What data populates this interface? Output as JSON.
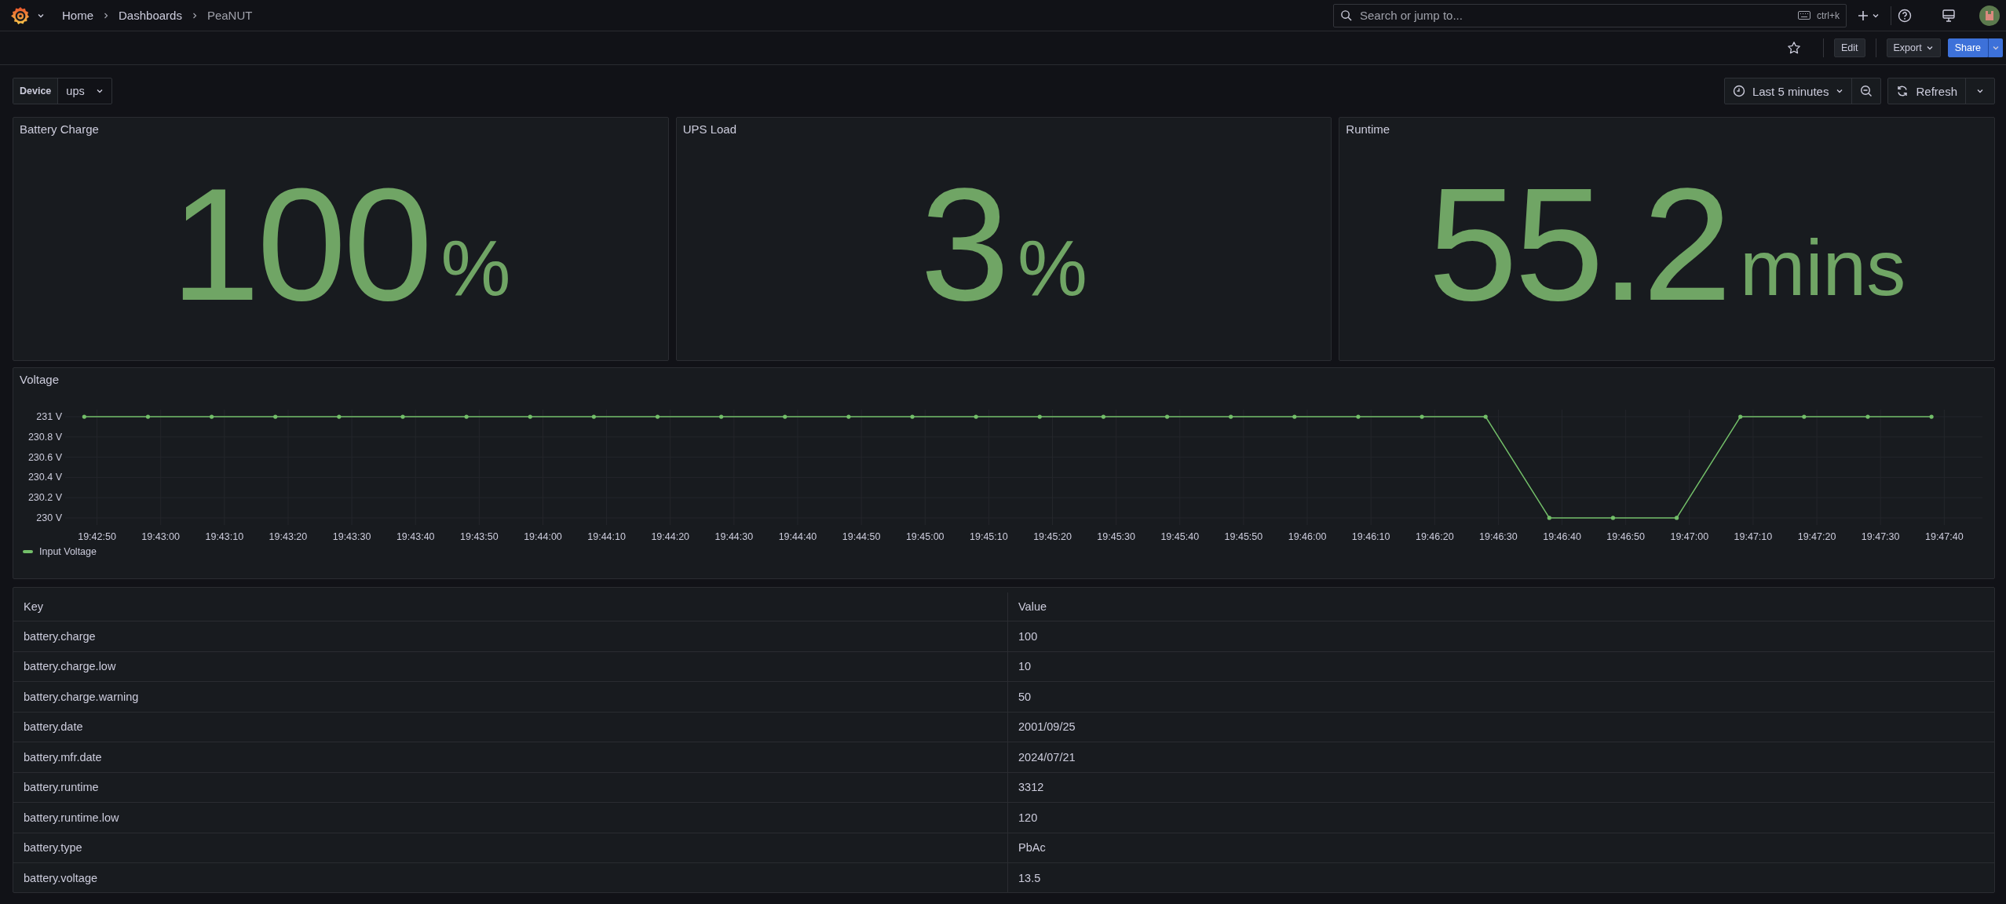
{
  "breadcrumbs": [
    "Home",
    "Dashboards",
    "PeaNUT"
  ],
  "search": {
    "placeholder": "Search or jump to...",
    "shortcut": "ctrl+k"
  },
  "toolbar": {
    "edit": "Edit",
    "export": "Export",
    "share": "Share"
  },
  "variable": {
    "label": "Device",
    "value": "ups"
  },
  "time_picker": {
    "range": "Last 5 minutes",
    "refresh": "Refresh"
  },
  "stats": [
    {
      "title": "Battery Charge",
      "value": "100",
      "unit": "%"
    },
    {
      "title": "UPS Load",
      "value": "3",
      "unit": "%"
    },
    {
      "title": "Runtime",
      "value": "55.2",
      "unit": "mins"
    }
  ],
  "voltage": {
    "title": "Voltage",
    "chart_data": {
      "type": "line",
      "categories": [
        "19:42:50",
        "19:43:00",
        "19:43:10",
        "19:43:20",
        "19:43:30",
        "19:43:40",
        "19:43:50",
        "19:44:00",
        "19:44:10",
        "19:44:20",
        "19:44:30",
        "19:44:40",
        "19:44:50",
        "19:45:00",
        "19:45:10",
        "19:45:20",
        "19:45:30",
        "19:45:40",
        "19:45:50",
        "19:46:00",
        "19:46:10",
        "19:46:20",
        "19:46:30",
        "19:46:40",
        "19:46:50",
        "19:47:00",
        "19:47:10",
        "19:47:20",
        "19:47:30",
        "19:47:40"
      ],
      "series": [
        {
          "name": "Input Voltage",
          "color": "#73bf69",
          "values": [
            231,
            231,
            231,
            231,
            231,
            231,
            231,
            231,
            231,
            231,
            231,
            231,
            231,
            231,
            231,
            231,
            231,
            231,
            231,
            231,
            231,
            231,
            231,
            230,
            230,
            230,
            231,
            231,
            231,
            231
          ]
        }
      ],
      "grid": true,
      "ylim": [
        230,
        231
      ],
      "yticks": [
        {
          "value": 230,
          "label": "230 V"
        },
        {
          "value": 230.2,
          "label": "230.2 V"
        },
        {
          "value": 230.4,
          "label": "230.4 V"
        },
        {
          "value": 230.6,
          "label": "230.6 V"
        },
        {
          "value": 230.8,
          "label": "230.8 V"
        },
        {
          "value": 231,
          "label": "231 V"
        }
      ]
    }
  },
  "table": {
    "columns": [
      "Key",
      "Value"
    ],
    "rows": [
      [
        "battery.charge",
        "100"
      ],
      [
        "battery.charge.low",
        "10"
      ],
      [
        "battery.charge.warning",
        "50"
      ],
      [
        "battery.date",
        "2001/09/25"
      ],
      [
        "battery.mfr.date",
        "2024/07/21"
      ],
      [
        "battery.runtime",
        "3312"
      ],
      [
        "battery.runtime.low",
        "120"
      ],
      [
        "battery.type",
        "PbAc"
      ],
      [
        "battery.voltage",
        "13.5"
      ]
    ]
  }
}
